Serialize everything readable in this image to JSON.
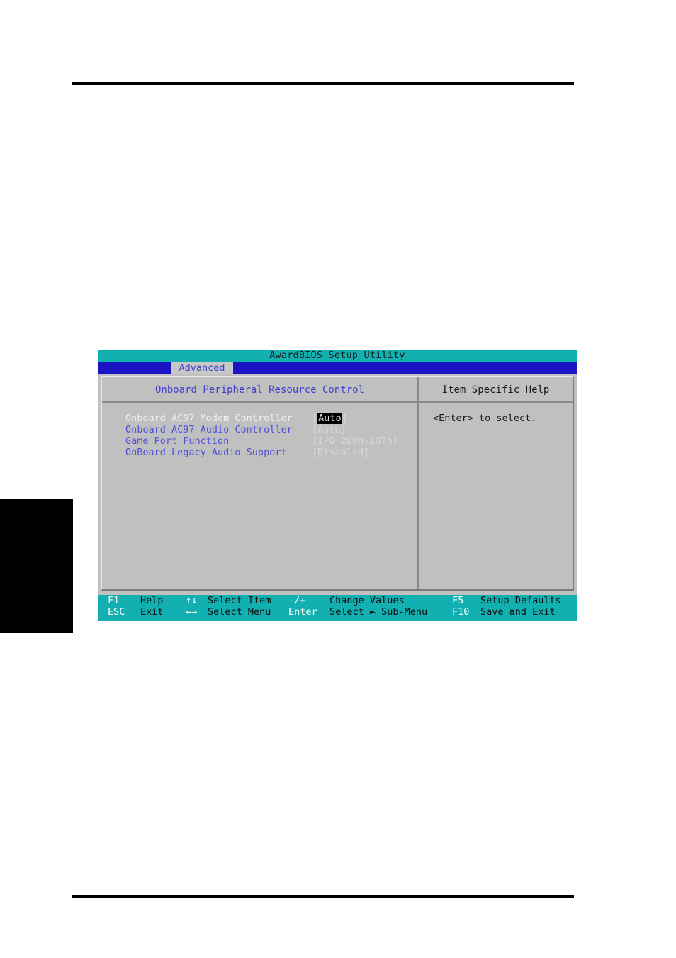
{
  "page": {
    "rule_top": "horizontal-rule",
    "rule_bottom": "horizontal-rule",
    "edge_tab": "black-chapter-tab"
  },
  "bios": {
    "title": "AwardBIOS Setup Utility",
    "active_tab": "Advanced",
    "section_title": "Onboard Peripheral Resource Control",
    "help_panel_title": "Item Specific Help",
    "help_text": "<Enter> to select.",
    "colors": {
      "titlebar": "#12b0b0",
      "tabstrip": "#1a14c4",
      "panel": "#c0c0c0",
      "label": "#5050d8",
      "selected_label": "#f0f0f0",
      "value": "#d8d8d8",
      "footer": "#12b0b0"
    },
    "settings": [
      {
        "label": "Onboard AC97 Modem Controller",
        "value": "Auto",
        "open_bracket": "[",
        "close_bracket": "]",
        "selected": true
      },
      {
        "label": "Onboard AC97 Audio Controller",
        "value": "Auto",
        "open_bracket": "[",
        "close_bracket": "]",
        "selected": false
      },
      {
        "label": "Game Port Function",
        "value": "I/O 200h-207h",
        "open_bracket": "[",
        "close_bracket": "]",
        "selected": false
      },
      {
        "label": "OnBoard Legacy Audio Support",
        "value": "Disabled",
        "open_bracket": "[",
        "close_bracket": "]",
        "selected": false
      }
    ],
    "footer": {
      "row1": [
        {
          "key": "F1",
          "desc": "Help"
        },
        {
          "key": "↑↓",
          "desc": "Select Item"
        },
        {
          "key": "-/+",
          "desc": "Change Values"
        },
        {
          "key": "F5",
          "desc": "Setup Defaults"
        }
      ],
      "row2": [
        {
          "key": "ESC",
          "desc": "Exit"
        },
        {
          "key": "←→",
          "desc": "Select Menu"
        },
        {
          "key": "Enter",
          "desc": "Select ► Sub-Menu"
        },
        {
          "key": "F10",
          "desc": "Save and Exit"
        }
      ]
    }
  }
}
